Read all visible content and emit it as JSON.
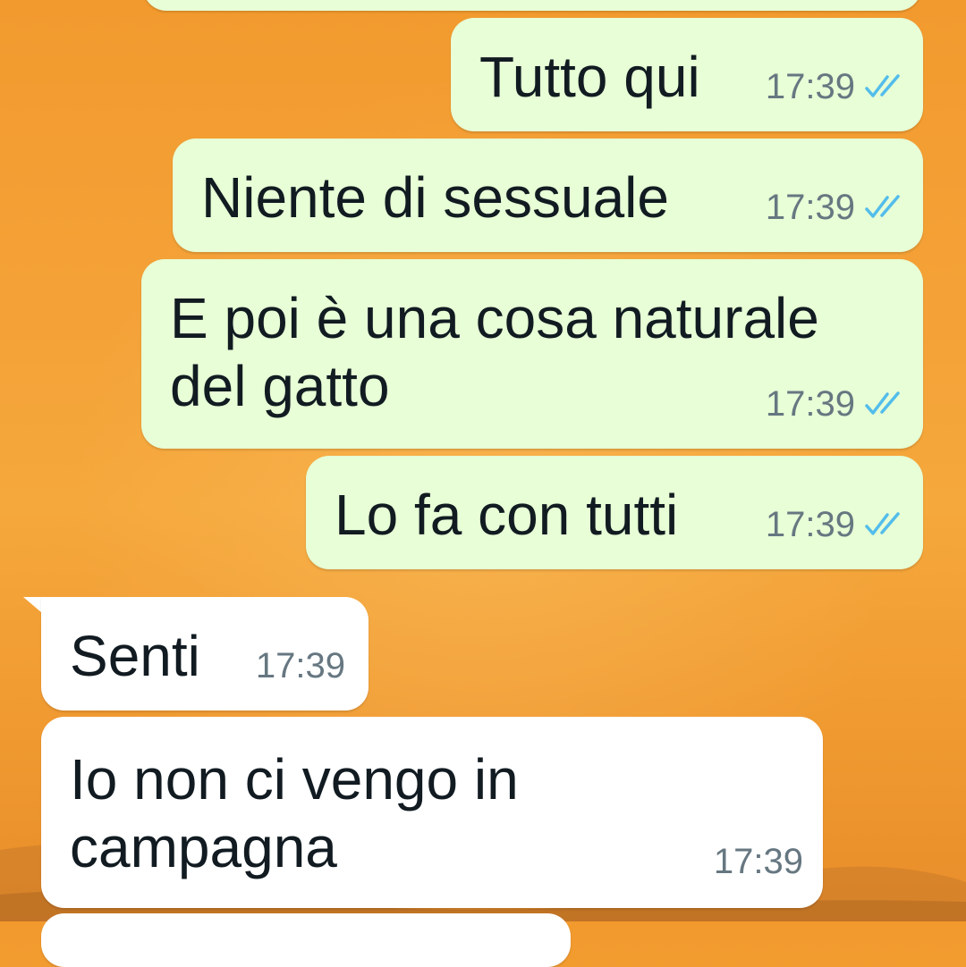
{
  "chat": {
    "messages": [
      {
        "direction": "outgoing",
        "lines": [
          "Tutto qui"
        ],
        "time": "17:39",
        "status": "read"
      },
      {
        "direction": "outgoing",
        "lines": [
          "Niente di sessuale"
        ],
        "time": "17:39",
        "status": "read"
      },
      {
        "direction": "outgoing",
        "lines": [
          "E poi è una cosa naturale",
          "del gatto"
        ],
        "time": "17:39",
        "status": "read"
      },
      {
        "direction": "outgoing",
        "lines": [
          "Lo fa con tutti"
        ],
        "time": "17:39",
        "status": "read"
      },
      {
        "direction": "incoming",
        "lines": [
          "Senti"
        ],
        "time": "17:39"
      },
      {
        "direction": "incoming",
        "lines": [
          "Io non ci vengo in",
          "campagna"
        ],
        "time": "17:39"
      }
    ]
  },
  "colors": {
    "outgoing_bubble": "#e7fed6",
    "incoming_bubble": "#ffffff",
    "read_ticks": "#53bdeb",
    "timestamp": "#667781",
    "wallpaper": "#f4a238"
  },
  "icons": {
    "read_status": "double-check-icon"
  }
}
